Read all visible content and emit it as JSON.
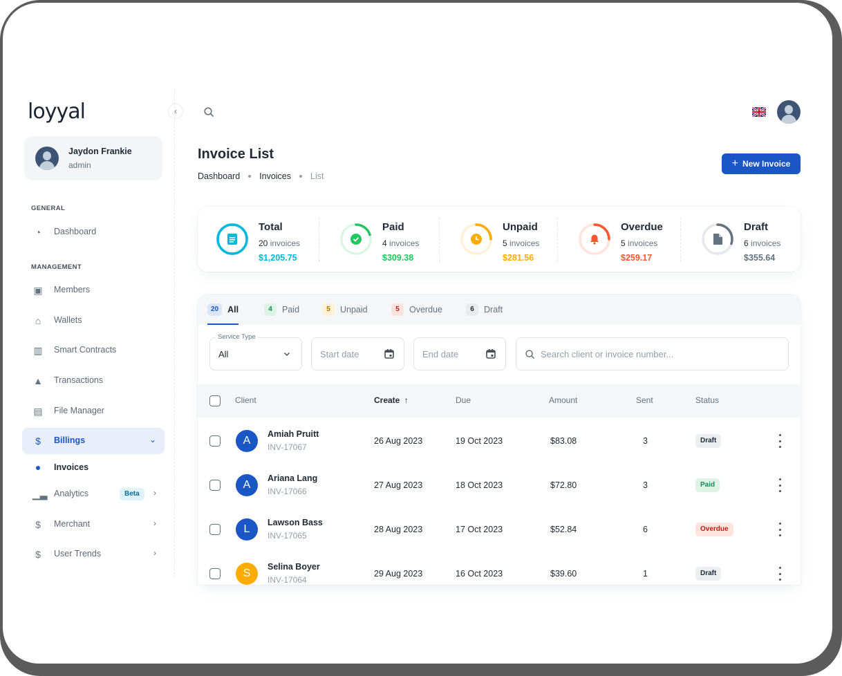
{
  "brand": {
    "logo_text": "loyyal"
  },
  "user": {
    "name": "Jaydon Frankie",
    "role": "admin"
  },
  "sidebar": {
    "general_label": "GENERAL",
    "management_label": "MANAGEMENT",
    "general_items": [
      {
        "label": "Dashboard",
        "icon": "dashboard-icon"
      }
    ],
    "management_items": [
      {
        "label": "Members",
        "icon": "user-icon"
      },
      {
        "label": "Wallets",
        "icon": "bank-icon"
      },
      {
        "label": "Smart Contracts",
        "icon": "kanban-icon"
      },
      {
        "label": "Transactions",
        "icon": "lock-icon"
      },
      {
        "label": "File Manager",
        "icon": "folder-icon"
      },
      {
        "label": "Billings",
        "icon": "invoice-icon",
        "active": true
      },
      {
        "label": "Analytics",
        "icon": "analytics-icon",
        "badge": "Beta"
      },
      {
        "label": "Merchant",
        "icon": "invoice-icon"
      },
      {
        "label": "User Trends",
        "icon": "invoice-icon"
      }
    ],
    "sub_item": "Invoices"
  },
  "page": {
    "title": "Invoice List",
    "breadcrumb": [
      "Dashboard",
      "Invoices",
      "List"
    ],
    "new_button": "New Invoice"
  },
  "stats": [
    {
      "title": "Total",
      "count": "20",
      "count_label": "invoices",
      "amount": "$1,205.75",
      "color": "#00b8d9",
      "percent": 100,
      "icon": "document-icon"
    },
    {
      "title": "Paid",
      "count": "4",
      "count_label": "invoices",
      "amount": "$309.38",
      "color": "#22c55e",
      "percent": 20,
      "icon": "check-icon"
    },
    {
      "title": "Unpaid",
      "count": "5",
      "count_label": "invoices",
      "amount": "$281.56",
      "color": "#ffab00",
      "percent": 25,
      "icon": "clock-icon"
    },
    {
      "title": "Overdue",
      "count": "5",
      "count_label": "invoices",
      "amount": "$259.17",
      "color": "#ff5630",
      "percent": 25,
      "icon": "bell-icon"
    },
    {
      "title": "Draft",
      "count": "6",
      "count_label": "invoices",
      "amount": "$355.64",
      "color": "#637381",
      "percent": 30,
      "icon": "file-icon"
    }
  ],
  "tabs": [
    {
      "label": "All",
      "count": "20",
      "active": true,
      "bg": "#dbe6f8",
      "fg": "#1a56c4"
    },
    {
      "label": "Paid",
      "count": "4",
      "bg": "#dcf3e6",
      "fg": "#118d57"
    },
    {
      "label": "Unpaid",
      "count": "5",
      "bg": "#fff1d6",
      "fg": "#b76e00"
    },
    {
      "label": "Overdue",
      "count": "5",
      "bg": "#ffe4de",
      "fg": "#b71d18"
    },
    {
      "label": "Draft",
      "count": "6",
      "bg": "#e9ecef",
      "fg": "#212b36"
    }
  ],
  "filters": {
    "service_label": "Service Type",
    "service_value": "All",
    "start_placeholder": "Start date",
    "end_placeholder": "End date",
    "search_placeholder": "Search client or invoice number..."
  },
  "table": {
    "headers": {
      "client": "Client",
      "create": "Create",
      "due": "Due",
      "amount": "Amount",
      "sent": "Sent",
      "status": "Status"
    },
    "rows": [
      {
        "initial": "A",
        "avatar_color": "#1a56c4",
        "name": "Amiah Pruitt",
        "invoice": "INV-17067",
        "create": "26 Aug 2023",
        "due": "19 Oct 2023",
        "amount": "$83.08",
        "sent": "3",
        "status": "Draft"
      },
      {
        "initial": "A",
        "avatar_color": "#1a56c4",
        "name": "Ariana Lang",
        "invoice": "INV-17066",
        "create": "27 Aug 2023",
        "due": "18 Oct 2023",
        "amount": "$72.80",
        "sent": "3",
        "status": "Paid"
      },
      {
        "initial": "L",
        "avatar_color": "#1a56c4",
        "name": "Lawson Bass",
        "invoice": "INV-17065",
        "create": "28 Aug 2023",
        "due": "17 Oct 2023",
        "amount": "$52.84",
        "sent": "6",
        "status": "Overdue"
      },
      {
        "initial": "S",
        "avatar_color": "#ffab00",
        "name": "Selina Boyer",
        "invoice": "INV-17064",
        "create": "29 Aug 2023",
        "due": "16 Oct 2023",
        "amount": "$39.60",
        "sent": "1",
        "status": "Draft"
      }
    ]
  },
  "status_styles": {
    "Draft": {
      "bg": "#eceff2",
      "fg": "#212b36"
    },
    "Paid": {
      "bg": "#dcf3e6",
      "fg": "#118d57"
    },
    "Overdue": {
      "bg": "#ffe4de",
      "fg": "#b71d18"
    }
  }
}
